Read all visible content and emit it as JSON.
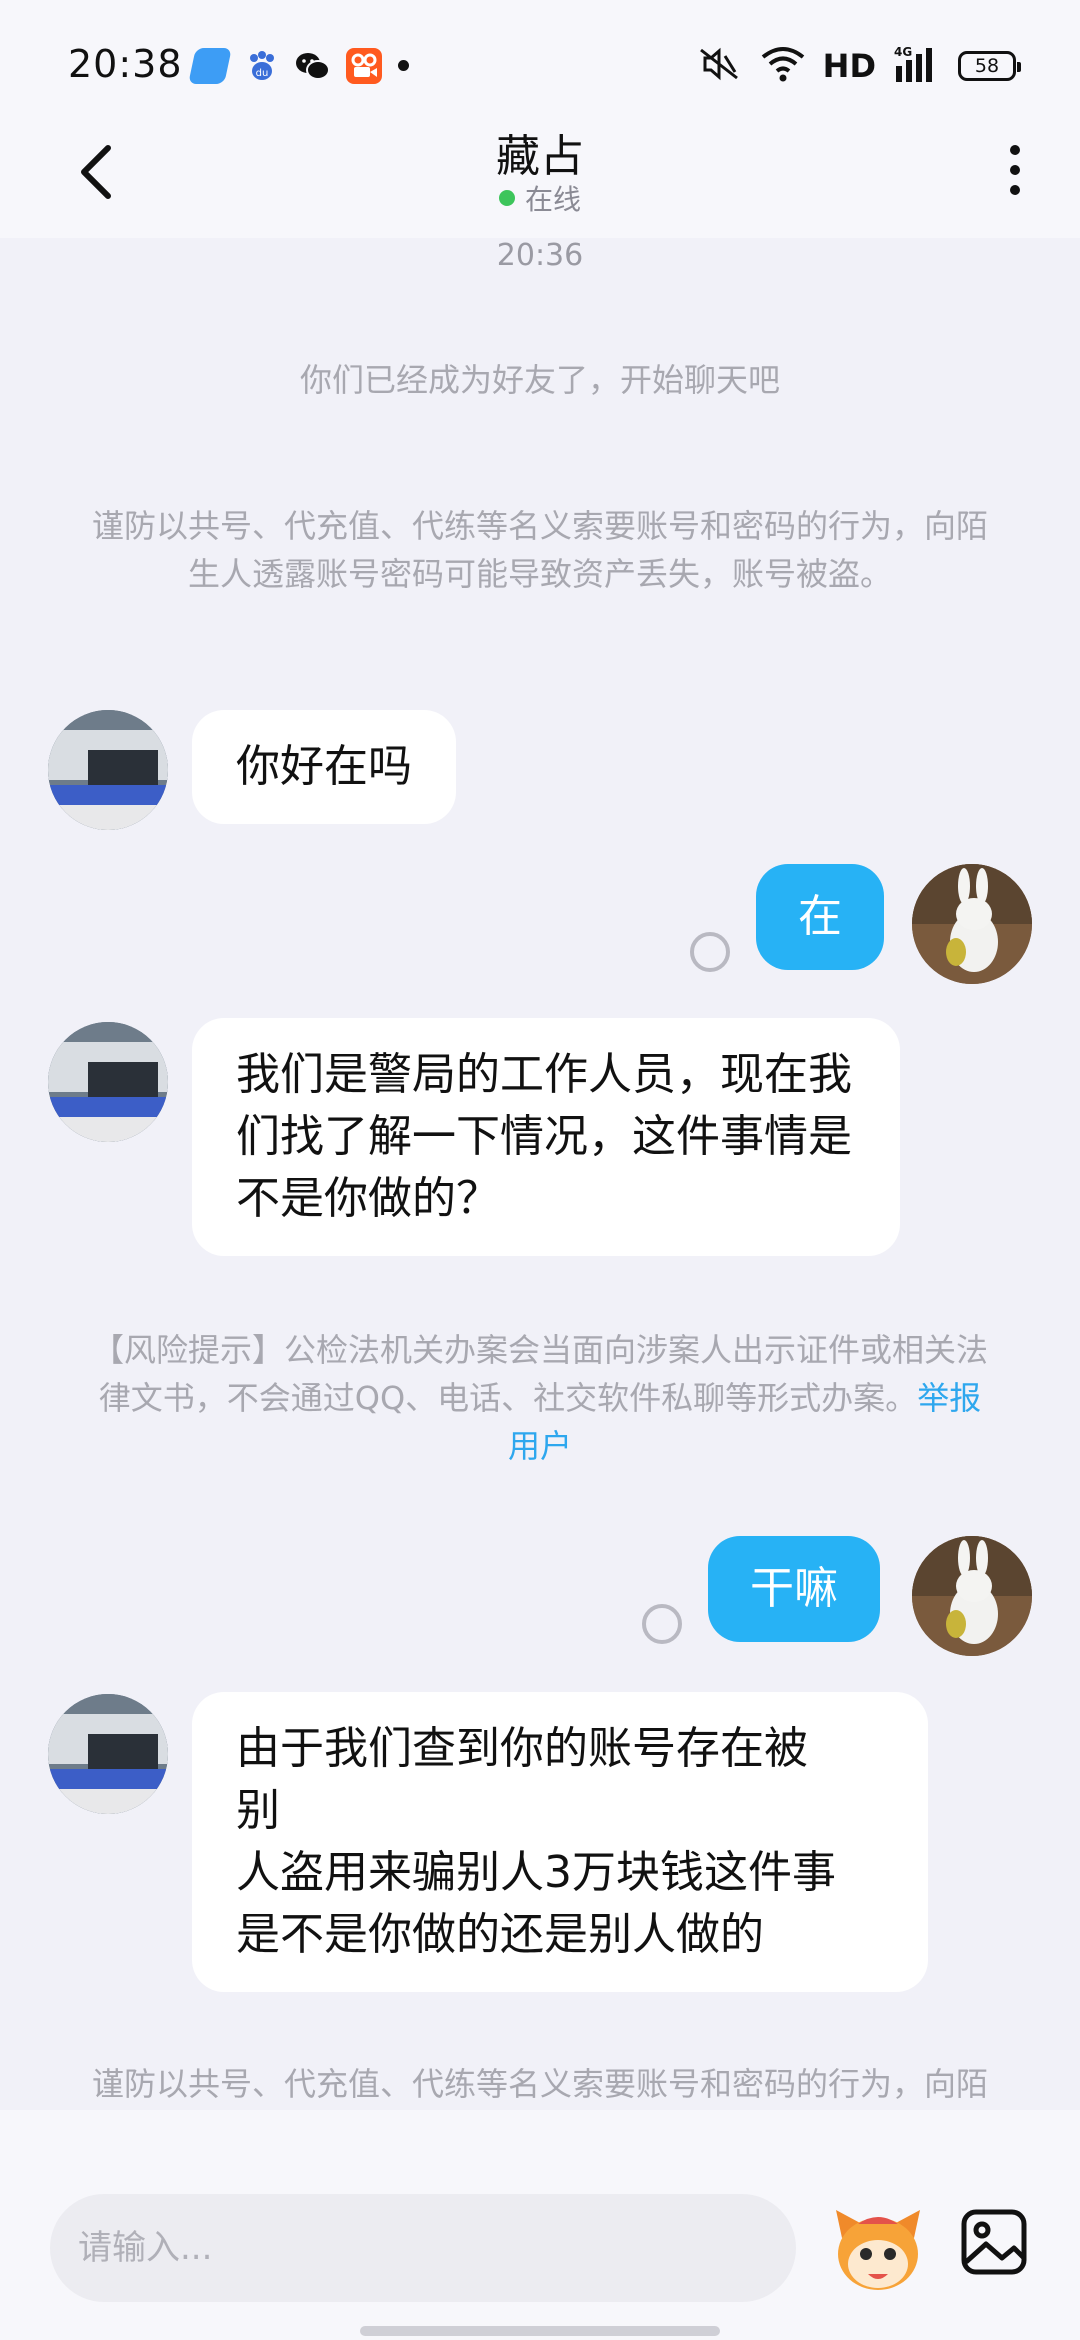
{
  "status_bar": {
    "time": "20:38",
    "network_label": "HD",
    "battery_level": "58",
    "icons": [
      "browser-app-icon",
      "baidu-icon",
      "wechat-icon",
      "kuaishou-icon",
      "mute-icon",
      "wifi-icon",
      "signal-4g-icon",
      "battery-icon"
    ]
  },
  "header": {
    "contact_name": "藏占",
    "status": "在线",
    "back_icon": "chevron-left-icon",
    "more_icon": "more-vertical-icon"
  },
  "messages": {
    "timestamp": "20:36",
    "system_friend": "你们已经成为好友了，开始聊天吧",
    "system_warning_1": "谨防以共号、代充值、代练等名义索要账号和密码的行为，向陌生人透露账号密码可能导致资产丢失，账号被盗。",
    "msg1": "你好在吗",
    "msg2": "在",
    "msg3": "我们是警局的工作人员，现在我们找了解一下情况，这件事情是不是你做的？",
    "risk_prefix": "【风险提示】公检法机关办案会当面向涉案人出示证件或相关法律文书，不会通过QQ、电话、社交软件私聊等形式办案。",
    "risk_link": "举报用户",
    "msg4": "干嘛",
    "msg5_line1": "由于我们查到你的账号存在被",
    "msg5_line2": "别",
    "msg5_line3": "人盗用来骗别人3万块钱这件事",
    "msg5_line4": "是不是你做的还是别人做的",
    "system_warning_2": "谨防以共号、代充值、代练等名义索要账号和密码的行为，向陌生人透露账号密码可能导致资产丢失，账号被盗。"
  },
  "input": {
    "placeholder": "请输入...",
    "value": ""
  },
  "colors": {
    "background": "#f1f1f8",
    "sent_bubble": "#27b2f5",
    "received_bubble": "#ffffff",
    "link": "#2ea7ee",
    "online": "#3dc55b"
  }
}
